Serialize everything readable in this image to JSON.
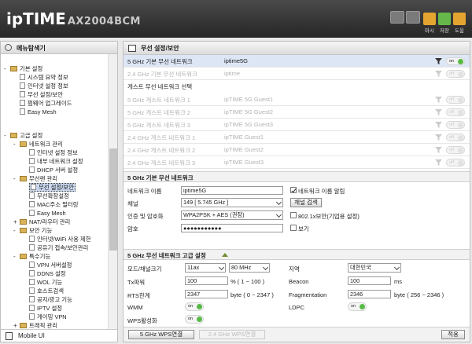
{
  "header": {
    "logo_main": "ipTIME",
    "logo_model": "AX2004BCM",
    "toolbar": [
      {
        "label": "마시",
        "color": "#e3a52f"
      },
      {
        "label": "저장",
        "color": "#66b84b"
      },
      {
        "label": "도움",
        "color": "#e3a52f"
      }
    ]
  },
  "sidebar": {
    "title": "메뉴탐색기",
    "basic_group": "기본 설정",
    "basic_items": [
      "시스템 요약 정보",
      "인터넷 설정 정보",
      "무선 설정/보안",
      "펌웨어 업그레이드",
      "Easy Mesh"
    ],
    "advanced_group": "고급 설정",
    "network": "네트워크 관리",
    "network_items": [
      "인터넷 설정 정보",
      "내부 네트워크 설정",
      "DHCP 서버 설정"
    ],
    "wireless": "무선랜 관리",
    "wireless_items": [
      "무선 설정/보안",
      "무선확장설정",
      "MAC주소 필터링",
      "Easy Mesh"
    ],
    "nat": "NAT/라우터 관리",
    "security": "보안 기능",
    "security_items": [
      "인터넷/WiFi 사용 제한",
      "공유기 접속/보안관리"
    ],
    "special": "특수기능",
    "special_items": [
      "VPN 서버설정",
      "DDNS 설정",
      "WOL 기능",
      "호스트검색",
      "공지/광고 기능",
      "IPTV 설정",
      "게이밍 VPN"
    ],
    "traffic": "트래픽 관리",
    "mobile_ui": "Mobile UI"
  },
  "main": {
    "title": "무선 설정/보안",
    "networks": [
      {
        "label": "5 GHz 기본 무선 네트워크",
        "ssid": "iptime5G",
        "state": "on",
        "dim": false,
        "active": true
      },
      {
        "label": "2.4 GHz 기본 무선 네트워크",
        "ssid": "iptime",
        "state": "off",
        "dim": true,
        "active": false
      }
    ],
    "guest_title": "게스트 무선 네트워크 선택",
    "guests": [
      {
        "label": "5 GHz 게스트 네트워크 1",
        "ssid": "ipTIME 5G Guest1"
      },
      {
        "label": "5 GHz 게스트 네트워크 2",
        "ssid": "ipTIME 5G Guest2"
      },
      {
        "label": "5 GHz 게스트 네트워크 3",
        "ssid": "ipTIME 5G Guest3"
      },
      {
        "label": "2.4 GHz 게스트 네트워크 1",
        "ssid": "ipTIME Guest1"
      },
      {
        "label": "2.4 GHz 게스트 네트워크 2",
        "ssid": "ipTIME Guest2"
      },
      {
        "label": "2.4 GHz 게스트 네트워크 3",
        "ssid": "ipTIME Guest3"
      }
    ],
    "basic_section": "5 GHz 기본 무선 네트워크",
    "name_label": "네트워크 이름",
    "name_value": "iptime5G",
    "hide_label": "네트워크 이름 알림",
    "channel_label": "채널",
    "channel_value": "149 [ 5.745 GHz ]",
    "channel_search": "채널 검색",
    "auth_label": "인증 및 암호화",
    "auth_value": "WPA2PSK + AES (권장)",
    "auth_8021x": "802.1x보안(기업용 설정)",
    "password_label": "암호",
    "password_value": "●●●●●●●●●●●",
    "show_label": "보기",
    "advanced_section": "5 GHz 무선 네트워크 고급 설정",
    "mode_label": "모드/채널크기",
    "mode_value": "11ax",
    "width_value": "80 MHz",
    "region_label": "지역",
    "region_value": "대한민국",
    "tx_label": "Tx파워",
    "tx_value": "100",
    "tx_unit": "% ( 1 ~ 100 )",
    "beacon_label": "Beacon",
    "beacon_value": "100",
    "beacon_unit": "ms",
    "rts_label": "RTS한계",
    "rts_value": "2347",
    "rts_unit": "byte ( 0 ~ 2347 )",
    "frag_label": "Fragmentation",
    "frag_value": "2346",
    "frag_unit": "byte ( 256 ~ 2346 )",
    "wmm_label": "WMM",
    "ldpc_label": "LDPC",
    "wps_label": "WPS활성화",
    "toggle_on": "on",
    "btn_5g_wps": "5 GHz WPS연결",
    "btn_24g_wps": "2.4 GHz WPS연결",
    "btn_apply": "적용"
  }
}
